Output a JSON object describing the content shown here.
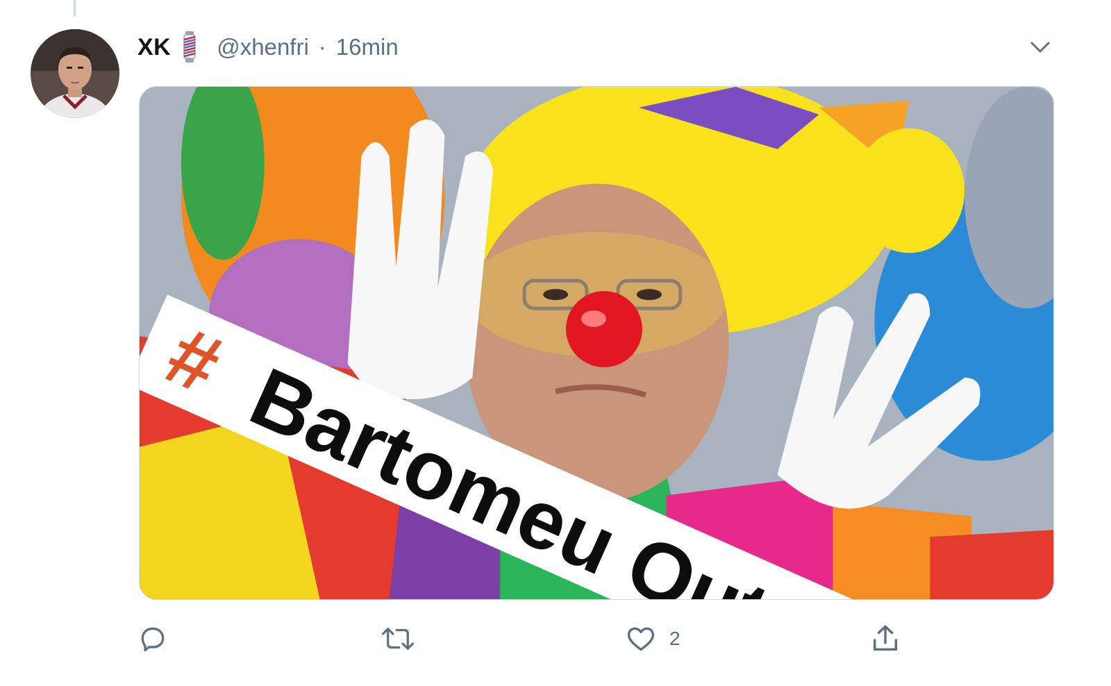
{
  "tweet": {
    "display_name": "XK",
    "badge_icon": "barber-pole-emoji",
    "handle": "@xhenfri",
    "separator": "·",
    "timestamp": "16min",
    "menu_icon": "chevron-down-icon",
    "media": {
      "description_icon": "clown-photo",
      "banner_hash": "#",
      "banner_text": "Bartomeu Out"
    },
    "actions": {
      "reply": {
        "icon": "reply-icon",
        "count": ""
      },
      "retweet": {
        "icon": "retweet-icon",
        "count": ""
      },
      "like": {
        "icon": "heart-icon",
        "count": "2"
      },
      "share": {
        "icon": "share-icon",
        "count": ""
      }
    }
  },
  "colors": {
    "text_primary": "#0f1419",
    "text_secondary": "#5b7083",
    "border": "#cfd9de",
    "hash_orange": "#e0542a"
  }
}
